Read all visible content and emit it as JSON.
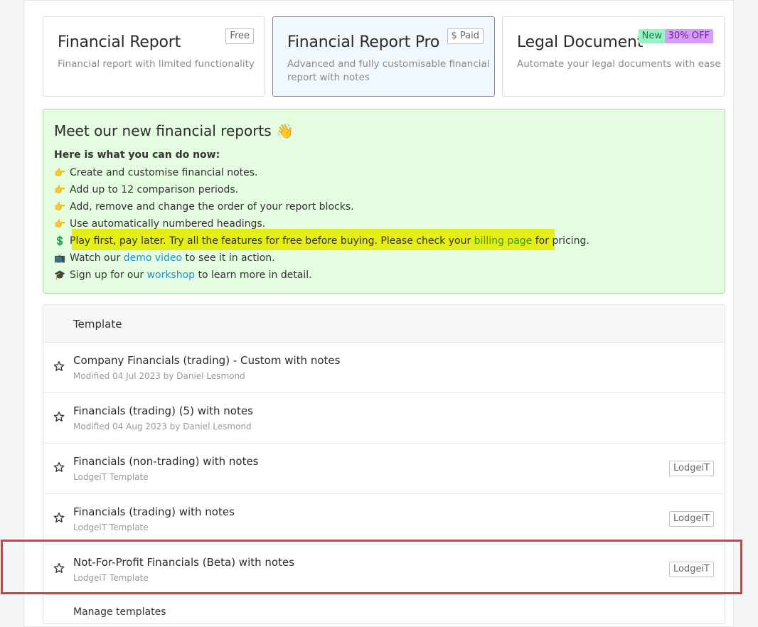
{
  "cards": [
    {
      "title": "Financial Report",
      "description": "Financial report with limited functionality",
      "badge": "Free"
    },
    {
      "title": "Financial Report Pro",
      "description_line1": "Advanced and fully customisable financial",
      "description_line2": "report with notes",
      "badge": "$ Paid"
    },
    {
      "title": "Legal Document",
      "description": "Automate your legal documents with ease",
      "badge_new": "New",
      "badge_off": "30% OFF"
    }
  ],
  "promo": {
    "title": "Meet our new financial reports 👋",
    "subtitle": "Here is what you can do now:",
    "items": [
      {
        "emoji": "👉",
        "text": "Create and customise financial notes."
      },
      {
        "emoji": "👉",
        "text": "Add up to 12 comparison periods."
      },
      {
        "emoji": "👉",
        "text": "Add, remove and change the order of your report blocks."
      },
      {
        "emoji": "👉",
        "text": "Use automatically numbered headings."
      }
    ],
    "pay": {
      "emoji": "💲",
      "text_before": "Play first, pay later. Try all the features for free before buying. Please check your ",
      "link": "billing page",
      "text_after": " for pricing."
    },
    "watch": {
      "emoji": "📺",
      "text_before": "Watch our ",
      "link": "demo video",
      "text_after": " to see it in action."
    },
    "signup": {
      "emoji": "🎓",
      "text_before": "Sign up for our ",
      "link": "workshop",
      "text_after": " to learn more in detail."
    }
  },
  "table": {
    "header": "Template",
    "rows": [
      {
        "title": "Company Financials (trading) - Custom with notes",
        "meta": "Modified 04 Jul 2023 by Daniel Lesmond",
        "badge": ""
      },
      {
        "title": "Financials (trading) (5) with notes",
        "meta": "Modified 04 Aug 2023 by Daniel Lesmond",
        "badge": ""
      },
      {
        "title": "Financials (non-trading) with notes",
        "meta": "LodgeiT Template",
        "badge": "LodgeiT"
      },
      {
        "title": "Financials (trading) with notes",
        "meta": "LodgeiT Template",
        "badge": "LodgeiT"
      },
      {
        "title": "Not-For-Profit Financials (Beta) with notes",
        "meta": "LodgeiT Template",
        "badge": "LodgeiT"
      }
    ],
    "manage": "Manage templates"
  }
}
